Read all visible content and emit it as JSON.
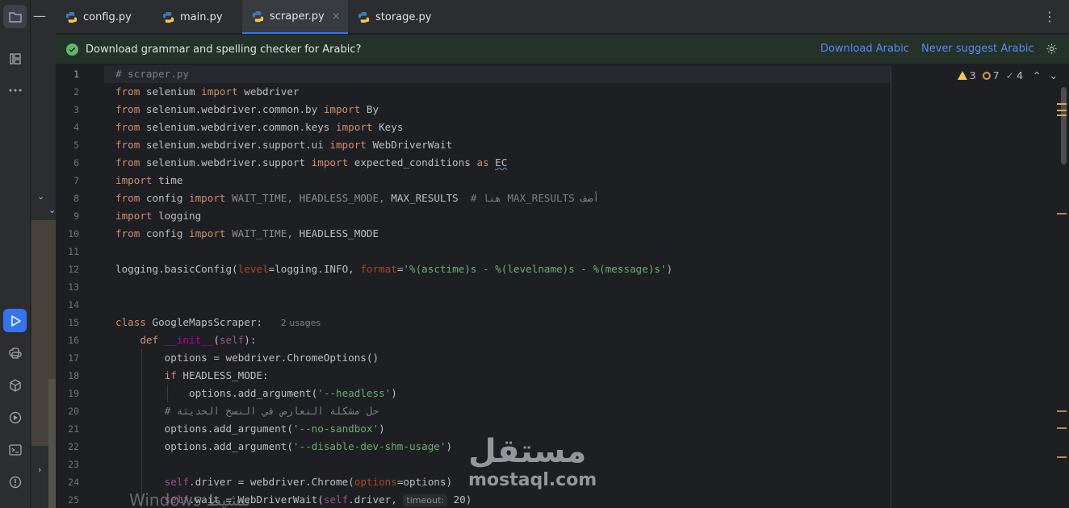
{
  "tabs": [
    {
      "label": "config.py",
      "active": false
    },
    {
      "label": "main.py",
      "active": false
    },
    {
      "label": "scraper.py",
      "active": true
    },
    {
      "label": "storage.py",
      "active": false
    }
  ],
  "tab_close_glyph": "×",
  "notification": {
    "message": "Download grammar and spelling checker for Arabic?",
    "download_link": "Download Arabic",
    "never_link": "Never suggest Arabic"
  },
  "inspections": {
    "warnings": "3",
    "weak_warnings": "7",
    "typos": "4"
  },
  "code": {
    "current_line": 1,
    "line_numbers": [
      "1",
      "2",
      "3",
      "4",
      "5",
      "6",
      "7",
      "8",
      "9",
      "10",
      "11",
      "12",
      "13",
      "14",
      "15",
      "16",
      "17",
      "18",
      "19",
      "20",
      "21",
      "22",
      "23",
      "24",
      "25"
    ],
    "l1": "# scraper.py",
    "l2": {
      "k1": "from",
      "a": " selenium ",
      "k2": "import",
      "b": " webdriver"
    },
    "l3": {
      "k1": "from",
      "a": " selenium.webdriver.common.by ",
      "k2": "import",
      "b": " By"
    },
    "l4": {
      "k1": "from",
      "a": " selenium.webdriver.common.keys ",
      "k2": "import",
      "b": " Keys"
    },
    "l5": {
      "k1": "from",
      "a": " selenium.webdriver.support.ui ",
      "k2": "import",
      "b": " WebDriverWait"
    },
    "l6": {
      "k1": "from",
      "a": " selenium.webdriver.support ",
      "k2": "import",
      "b": " expected_conditions ",
      "k3": "as",
      "c": " ",
      "d": "EC"
    },
    "l7": {
      "k1": "import",
      "a": " time"
    },
    "l8": {
      "k1": "from",
      "a": " config ",
      "k2": "import",
      "b": " WAIT_TIME, HEADLESS_MODE,",
      "c": " MAX_RESULTS  ",
      "d": "# هنا MAX_RESULTS أضف"
    },
    "l9": {
      "k1": "import",
      "a": " logging"
    },
    "l10": {
      "k1": "from",
      "a": " config ",
      "k2": "import",
      "b": " WAIT_TIME, ",
      "c": "HEADLESS_MODE"
    },
    "l12": {
      "a": "logging.basicConfig(",
      "p1": "level",
      "b": "=logging.INFO, ",
      "p2": "format",
      "c": "=",
      "s": "'%(asctime)s - %(levelname)s - %(message)s'",
      "d": ")"
    },
    "l15": {
      "k1": "class",
      "a": " GoogleMapsScraper:",
      "hint": "2 usages"
    },
    "l16": {
      "k1": "def",
      "a": " ",
      "fn": "__init__",
      "b": "(",
      "self": "self",
      "c": "):"
    },
    "l17": "options = webdriver.ChromeOptions()",
    "l18": {
      "k1": "if",
      "a": " HEADLESS_MODE:"
    },
    "l19": {
      "a": "options.add_argument(",
      "s": "'--headless'",
      "b": ")"
    },
    "l20": "# حل مشكلة التعارض في النسخ الحديثة",
    "l21": {
      "a": "options.add_argument(",
      "s": "'--no-sandbox'",
      "b": ")"
    },
    "l22": {
      "a": "options.add_argument(",
      "s": "'--disable-dev-shm-usage'",
      "b": ")"
    },
    "l24": {
      "self": "self",
      "a": ".driver = webdriver.Chrome(",
      "p": "options",
      "b": "=options)"
    },
    "l25": {
      "self": "self",
      "a": ".wait = WebDriverWait(",
      "self2": "self",
      "b": ".driver, ",
      "inlay": "timeout:",
      "c": " 20)"
    }
  },
  "watermark": {
    "arabic": "مستقل",
    "latin": "mostaql.com"
  },
  "os_watermark": "Windows تنشيط"
}
